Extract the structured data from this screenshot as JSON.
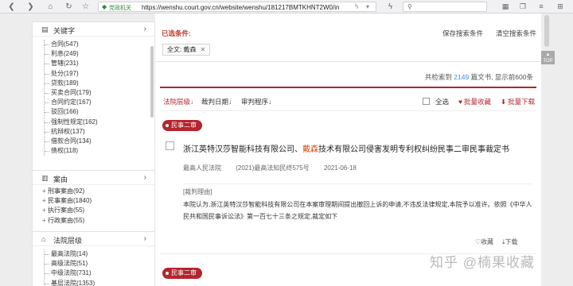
{
  "browser": {
    "agency_label": "党政机关",
    "url": "https://wenshu.court.gov.cn/website/wenshu/181217BMTKHNT2W0/in"
  },
  "left_panels": {
    "keyword": {
      "title": "关键字",
      "items": [
        "合同(547)",
        "利息(249)",
        "管辖(231)",
        "处分(197)",
        "贷款(189)",
        "买卖合同(179)",
        "合同约定(167)",
        "驳回(166)",
        "强制性规定(162)",
        "抗辩权(137)",
        "借款合同(134)",
        "债权(118)"
      ]
    },
    "cause": {
      "title": "案由",
      "items": [
        "刑事案由(92)",
        "民事案由(1840)",
        "执行案由(55)",
        "行政案由(55)"
      ]
    },
    "court": {
      "title": "法院层级",
      "items": [
        "最高法院(14)",
        "高级法院(51)",
        "中级法院(731)",
        "基层法院(1353)"
      ]
    }
  },
  "main": {
    "selected_label": "已选条件:",
    "save_search": "保存搜索条件",
    "clear_search": "清空搜索条件",
    "chip_text": "全文: 戴森",
    "chip_close": "✕",
    "summary_prefix": "共检索到 ",
    "summary_count": "2149",
    "summary_suffix": " 篇文书, 显示前600条",
    "sort_court": "法院层级",
    "sort_date": "裁判日期",
    "sort_procedure": "审判程序",
    "select_all": "全选",
    "bulk_collect": "批量收藏",
    "bulk_download": "批量下载"
  },
  "card": {
    "tag": "民事二审",
    "title_before": "浙江英特汉莎智能科技有限公司、",
    "title_highlight": "戴森",
    "title_after": "技术有限公司侵害发明专利权纠纷民事二审民事裁定书",
    "court": "最高人民法院",
    "case_no": "(2021)最高法知民终575号",
    "date": "2021-06-18",
    "reason_label": "[裁判理由]",
    "reason_text": "本院认为,浙江英特汉莎智能科技有限公司在本案审理期间提出撤回上诉的申请,不违反法律规定,本院予以准许。依照《中华人民共和国民事诉讼法》第一百七十三条之规定,裁定如下",
    "collect": "收藏",
    "download": "下载"
  },
  "next_card": {
    "tag": "民事二审"
  },
  "scroll_top_label": "TOP",
  "watermark": "知乎 @楠果收藏"
}
